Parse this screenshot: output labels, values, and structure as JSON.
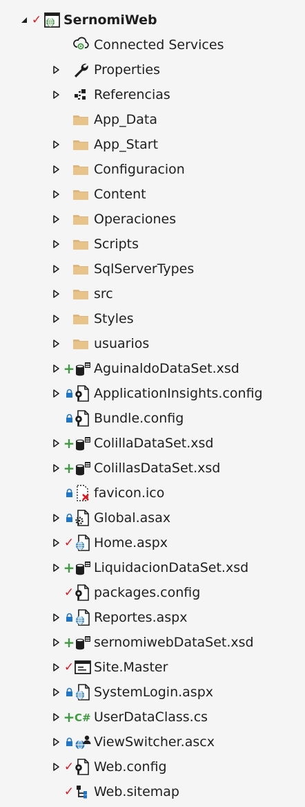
{
  "solution_explorer": {
    "root": {
      "label": "SernomiWeb",
      "icon": "web-project-icon",
      "status": "check",
      "expanded": true
    },
    "items": [
      {
        "label": "Connected Services",
        "icon": "connected-services-icon",
        "expander": false,
        "status": ""
      },
      {
        "label": "Properties",
        "icon": "wrench-icon",
        "expander": true,
        "status": ""
      },
      {
        "label": "Referencias",
        "icon": "references-icon",
        "expander": true,
        "status": ""
      },
      {
        "label": "App_Data",
        "icon": "folder-icon",
        "expander": false,
        "status": ""
      },
      {
        "label": "App_Start",
        "icon": "folder-icon",
        "expander": true,
        "status": ""
      },
      {
        "label": "Configuracion",
        "icon": "folder-icon",
        "expander": true,
        "status": ""
      },
      {
        "label": "Content",
        "icon": "folder-icon",
        "expander": true,
        "status": ""
      },
      {
        "label": "Operaciones",
        "icon": "folder-icon",
        "expander": true,
        "status": ""
      },
      {
        "label": "Scripts",
        "icon": "folder-icon",
        "expander": true,
        "status": ""
      },
      {
        "label": "SqlServerTypes",
        "icon": "folder-icon",
        "expander": true,
        "status": ""
      },
      {
        "label": "src",
        "icon": "folder-icon",
        "expander": true,
        "status": ""
      },
      {
        "label": "Styles",
        "icon": "folder-icon",
        "expander": true,
        "status": ""
      },
      {
        "label": "usuarios",
        "icon": "folder-icon",
        "expander": true,
        "status": ""
      },
      {
        "label": "AguinaldoDataSet.xsd",
        "icon": "dataset-icon",
        "expander": true,
        "status": "plus"
      },
      {
        "label": "ApplicationInsights.config",
        "icon": "config-file-icon",
        "expander": true,
        "status": "lock"
      },
      {
        "label": "Bundle.config",
        "icon": "config-file-icon",
        "expander": false,
        "status": "lock"
      },
      {
        "label": "ColillaDataSet.xsd",
        "icon": "dataset-icon",
        "expander": true,
        "status": "plus"
      },
      {
        "label": "ColillasDataSet.xsd",
        "icon": "dataset-icon",
        "expander": true,
        "status": "plus"
      },
      {
        "label": "favicon.ico",
        "icon": "missing-file-icon",
        "expander": false,
        "status": "lock"
      },
      {
        "label": "Global.asax",
        "icon": "asax-file-icon",
        "expander": true,
        "status": "lock"
      },
      {
        "label": "Home.aspx",
        "icon": "web-page-icon",
        "expander": true,
        "status": "check"
      },
      {
        "label": "LiquidacionDataSet.xsd",
        "icon": "dataset-icon",
        "expander": true,
        "status": "plus"
      },
      {
        "label": "packages.config",
        "icon": "config-file-icon",
        "expander": false,
        "status": "check"
      },
      {
        "label": "Reportes.aspx",
        "icon": "web-page-icon",
        "expander": true,
        "status": "lock"
      },
      {
        "label": "sernomiwebDataSet.xsd",
        "icon": "dataset-icon",
        "expander": true,
        "status": "plus"
      },
      {
        "label": "Site.Master",
        "icon": "master-page-icon",
        "expander": true,
        "status": "check"
      },
      {
        "label": "SystemLogin.aspx",
        "icon": "web-page-icon",
        "expander": true,
        "status": "lock"
      },
      {
        "label": "UserDataClass.cs",
        "icon": "csharp-file-icon",
        "expander": true,
        "status": "plus"
      },
      {
        "label": "ViewSwitcher.ascx",
        "icon": "user-control-icon",
        "expander": true,
        "status": "lock"
      },
      {
        "label": "Web.config",
        "icon": "config-file-icon",
        "expander": true,
        "status": "check"
      },
      {
        "label": "Web.sitemap",
        "icon": "sitemap-icon",
        "expander": false,
        "status": "check"
      }
    ]
  },
  "colors": {
    "background": "#f5f5f5",
    "text": "#1e1e1e",
    "check": "#e5141c",
    "plus": "#3e9b3e",
    "lock": "#1d76c9",
    "folder": "#dcb67a"
  }
}
